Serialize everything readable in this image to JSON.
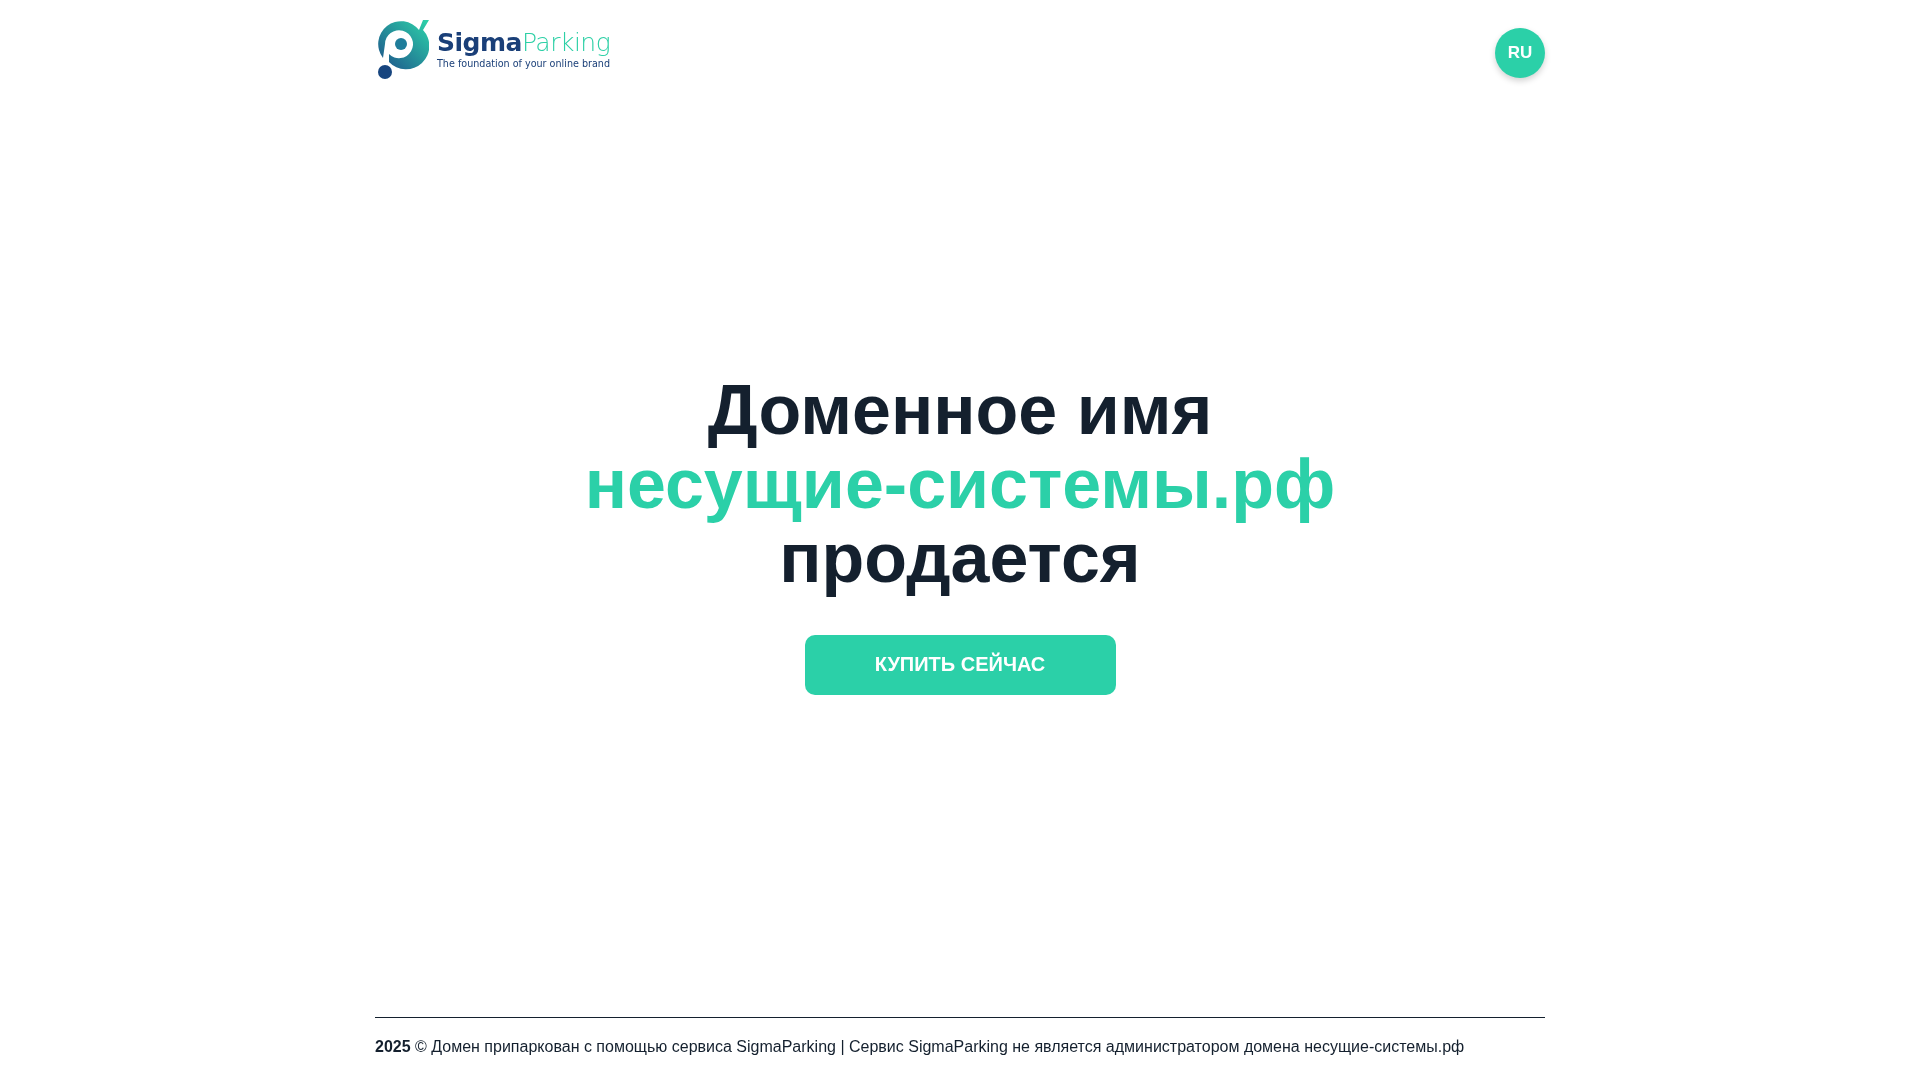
{
  "header": {
    "logo": {
      "name_bold": "Sigma",
      "name_light": "Parking",
      "tagline": "The foundation of your online brand"
    },
    "language_button": "RU"
  },
  "hero": {
    "line_1": "Доменное имя",
    "domain": "несущие-системы.рф",
    "line_3": "продается",
    "buy_button": "КУПИТЬ СЕЙЧАС"
  },
  "footer": {
    "text": "**2025** © Домен припаркован с помощью сервиса SigmaParking | Сервис SigmaParking не является администратором домена несущие-системы.рф"
  }
}
